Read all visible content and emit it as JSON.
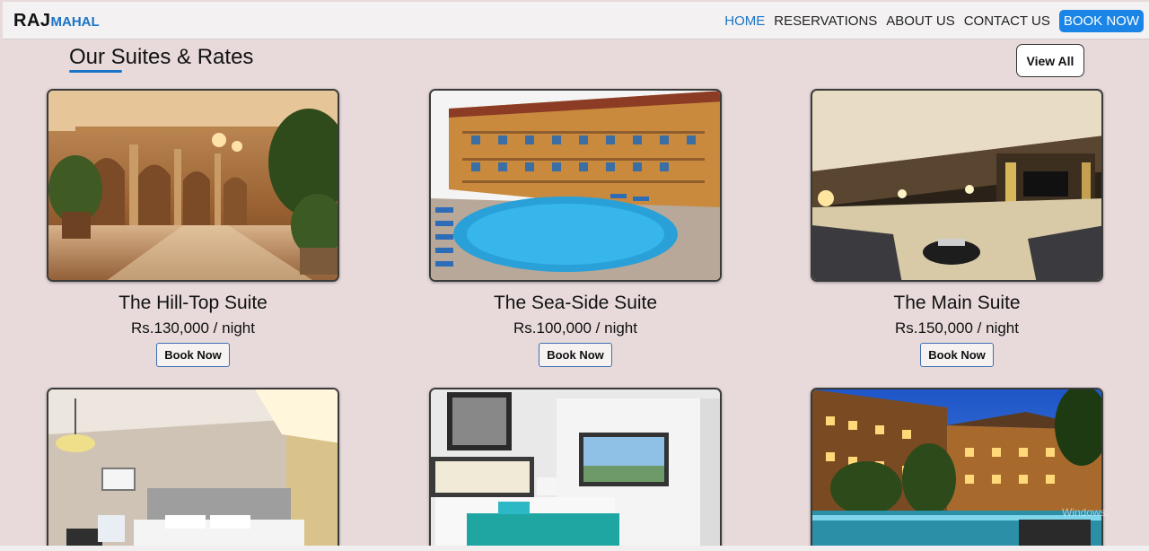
{
  "brand": {
    "raj": "RAJ",
    "mahal": "MAHAL"
  },
  "nav": {
    "home": "HOME",
    "reservations": "RESERVATIONS",
    "about": "ABOUT US",
    "contact": "CONTACT US",
    "book_now": "BOOK NOW"
  },
  "section": {
    "title": "Our Suites & Rates",
    "view_all": "View All"
  },
  "suites": [
    {
      "name": "The Hill-Top Suite",
      "price": "Rs.130,000 / night",
      "cta": "Book Now"
    },
    {
      "name": "The Sea-Side Suite",
      "price": "Rs.100,000 / night",
      "cta": "Book Now"
    },
    {
      "name": "The Main Suite",
      "price": "Rs.150,000 / night",
      "cta": "Book Now"
    }
  ],
  "watermark": "Windows.",
  "colors": {
    "accent": "#1a74c7",
    "cta_bg": "#1a85e6",
    "page_bg": "#e8dada"
  }
}
